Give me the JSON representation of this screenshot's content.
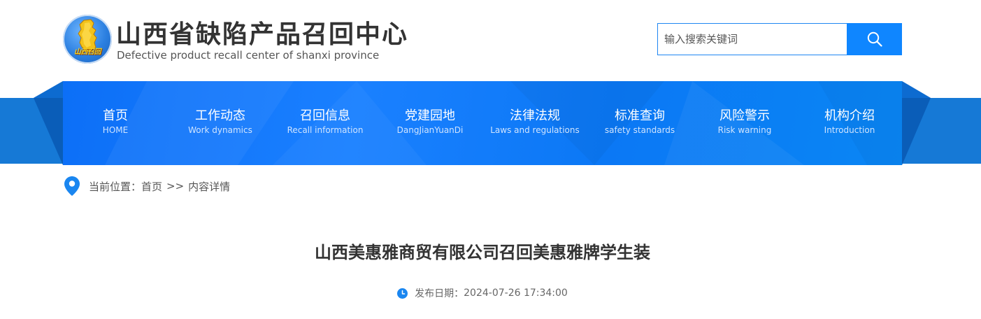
{
  "header": {
    "logo_text": "山西召回",
    "title": "山西省缺陷产品召回中心",
    "subtitle": "Defective product recall center of shanxi province",
    "search": {
      "placeholder": "输入搜索关键词",
      "button_icon": "search-icon"
    }
  },
  "nav": {
    "items": [
      {
        "cn": "首页",
        "en": "HOME"
      },
      {
        "cn": "工作动态",
        "en": "Work dynamics"
      },
      {
        "cn": "召回信息",
        "en": "Recall information"
      },
      {
        "cn": "党建园地",
        "en": "DangJianYuanDi"
      },
      {
        "cn": "法律法规",
        "en": "Laws and regulations"
      },
      {
        "cn": "标准查询",
        "en": "safety standards"
      },
      {
        "cn": "风险警示",
        "en": "Risk warning"
      },
      {
        "cn": "机构介绍",
        "en": "Introduction"
      }
    ]
  },
  "breadcrumb": {
    "icon": "location-pin-icon",
    "prefix": "当前位置：",
    "home": "首页",
    "separator": ">>",
    "current": "内容详情"
  },
  "article": {
    "title": "山西美惠雅商贸有限公司召回美惠雅牌学生装",
    "meta": {
      "icon": "clock-icon",
      "date_label": "发布日期：",
      "date_value": "2024-07-26 17:34:00"
    }
  },
  "colors": {
    "primary": "#0f86ff",
    "nav_band": "#1679d6",
    "title_text": "#333333"
  }
}
